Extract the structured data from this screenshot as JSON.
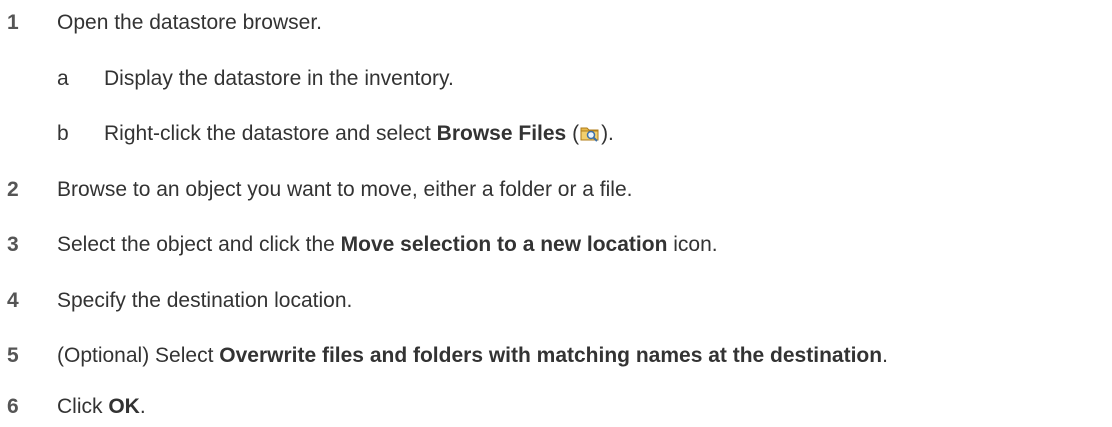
{
  "steps": [
    {
      "num": "1",
      "text": "Open the datastore browser."
    },
    {
      "letter": "a",
      "text": "Display the datastore in the inventory."
    },
    {
      "letter": "b",
      "pre": "Right-click the datastore and select ",
      "bold": "Browse Files",
      "mid": " (",
      "icon": "browse-files-icon",
      "post": ")."
    },
    {
      "num": "2",
      "text": "Browse to an object you want to move, either a folder or a file."
    },
    {
      "num": "3",
      "pre": "Select the object and click the ",
      "bold": "Move selection to a new location",
      "post": " icon."
    },
    {
      "num": "4",
      "text": "Specify the destination location."
    },
    {
      "num": "5",
      "pre": "(Optional) Select ",
      "bold": "Overwrite files and folders with matching names at the destination",
      "post": "."
    },
    {
      "num": "6",
      "pre": "Click ",
      "bold": "OK",
      "post": "."
    }
  ],
  "colors": {
    "text": "#333333",
    "step_number": "#555555"
  }
}
